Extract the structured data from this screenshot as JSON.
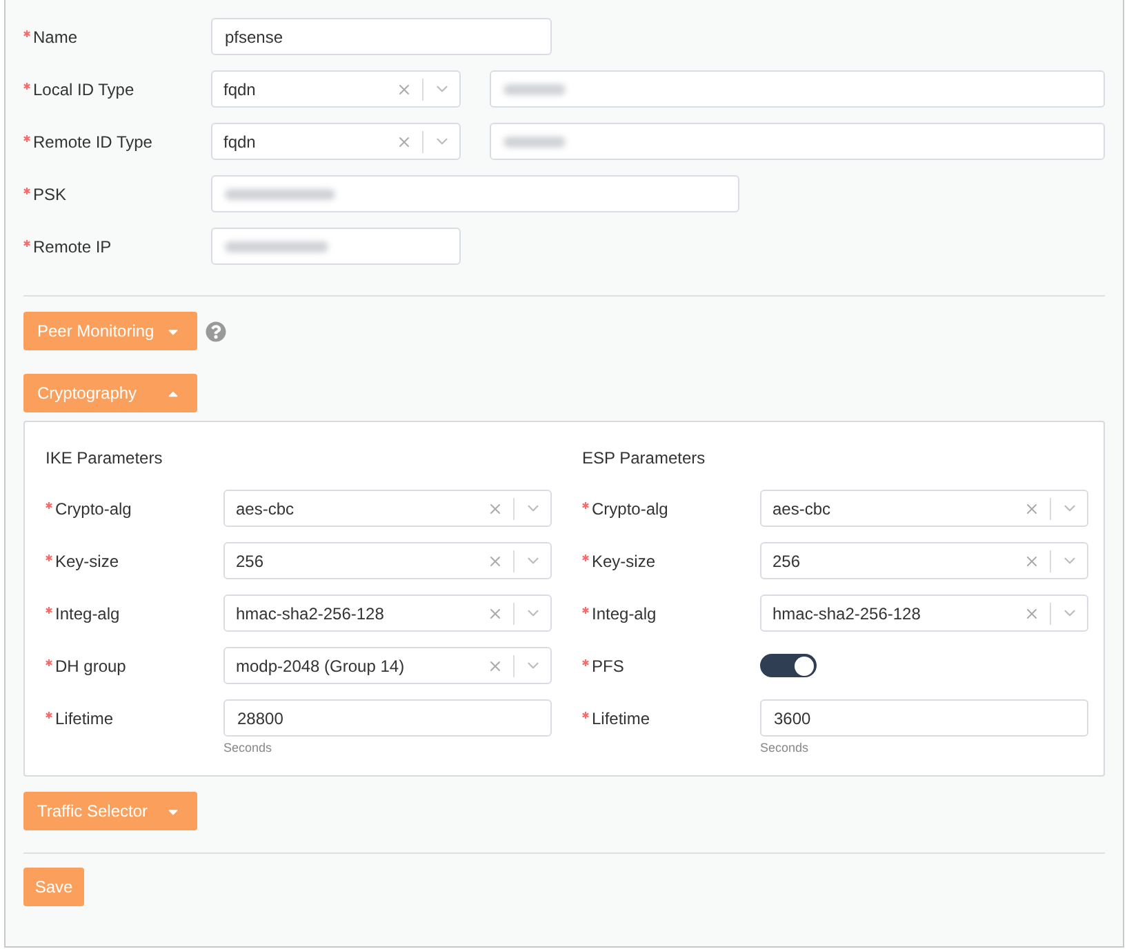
{
  "general_fields": [
    {
      "label": "Name",
      "required": true,
      "kind": "text",
      "value": "pfsense"
    },
    {
      "label": "Local ID Type",
      "required": true,
      "kind": "id-select",
      "value": "fqdn"
    },
    {
      "label": "Remote ID Type",
      "required": true,
      "kind": "id-select",
      "value": "fqdn"
    },
    {
      "label": "PSK",
      "required": true,
      "kind": "masked-wide"
    },
    {
      "label": "Remote IP",
      "required": true,
      "kind": "masked-short"
    }
  ],
  "sections": [
    {
      "label": "Peer Monitoring",
      "expanded": false,
      "help": true
    },
    {
      "label": "Cryptography",
      "expanded": true,
      "columns": [
        {
          "title": "IKE Parameters",
          "fields": [
            {
              "label": "Crypto-alg",
              "required": true,
              "kind": "select",
              "value": "aes-cbc"
            },
            {
              "label": "Key-size",
              "required": true,
              "kind": "select",
              "value": "256"
            },
            {
              "label": "Integ-alg",
              "required": true,
              "kind": "select",
              "value": "hmac-sha2-256-128"
            },
            {
              "label": "DH group",
              "required": true,
              "kind": "select",
              "value": "modp-2048 (Group 14)"
            },
            {
              "label": "Lifetime",
              "required": true,
              "kind": "text",
              "value": "28800",
              "hint": "Seconds"
            }
          ]
        },
        {
          "title": "ESP Parameters",
          "fields": [
            {
              "label": "Crypto-alg",
              "required": true,
              "kind": "select",
              "value": "aes-cbc"
            },
            {
              "label": "Key-size",
              "required": true,
              "kind": "select",
              "value": "256"
            },
            {
              "label": "Integ-alg",
              "required": true,
              "kind": "select",
              "value": "hmac-sha2-256-128"
            },
            {
              "label": "PFS",
              "required": true,
              "kind": "toggle",
              "on": true
            },
            {
              "label": "Lifetime",
              "required": true,
              "kind": "text",
              "value": "3600",
              "hint": "Seconds"
            }
          ]
        }
      ]
    },
    {
      "label": "Traffic Selector",
      "expanded": false
    }
  ],
  "save_button": "Save"
}
